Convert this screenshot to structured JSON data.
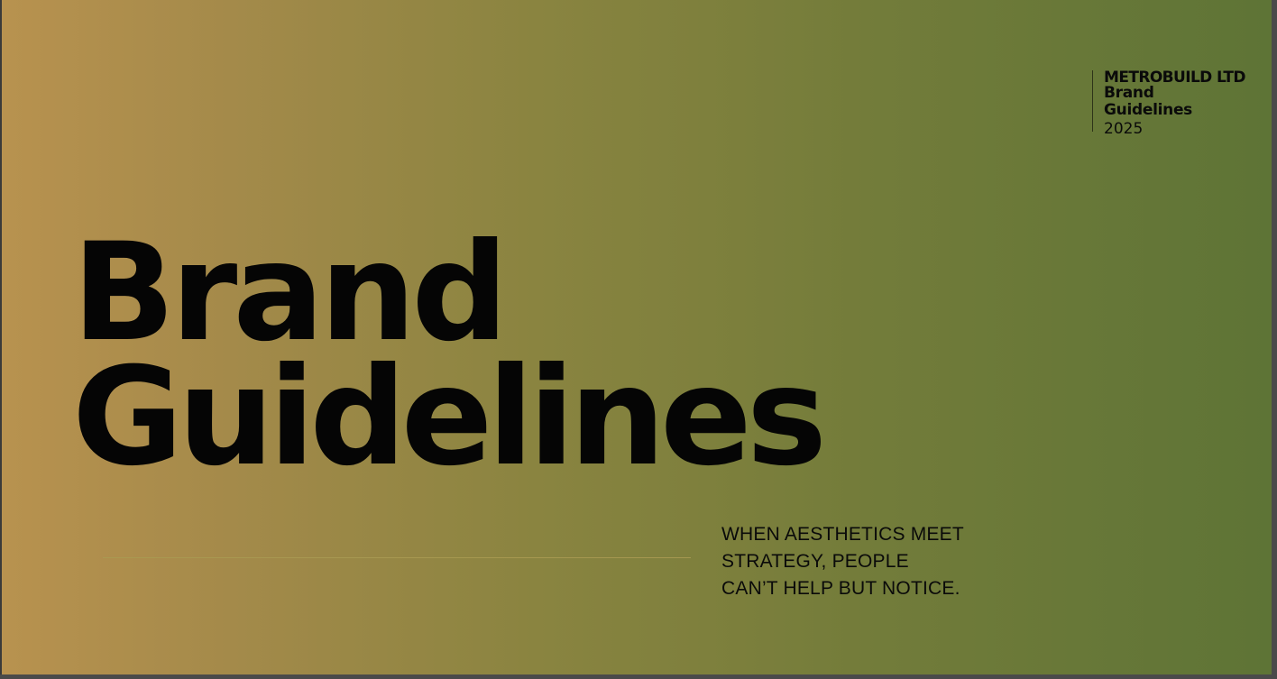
{
  "slide": {
    "background_gradient": [
      "#b8924f",
      "#5e7436"
    ],
    "corner_block": {
      "company": "METROBUILD LTD",
      "document_title": "Brand Guidelines",
      "year": "2025"
    },
    "headline": {
      "line1": "Brand",
      "line2": "Guidelines"
    },
    "tagline": {
      "line1": "WHEN AESTHETICS MEET",
      "line2": "STRATEGY, PEOPLE",
      "line3": "CAN’T HELP BUT NOTICE."
    }
  }
}
